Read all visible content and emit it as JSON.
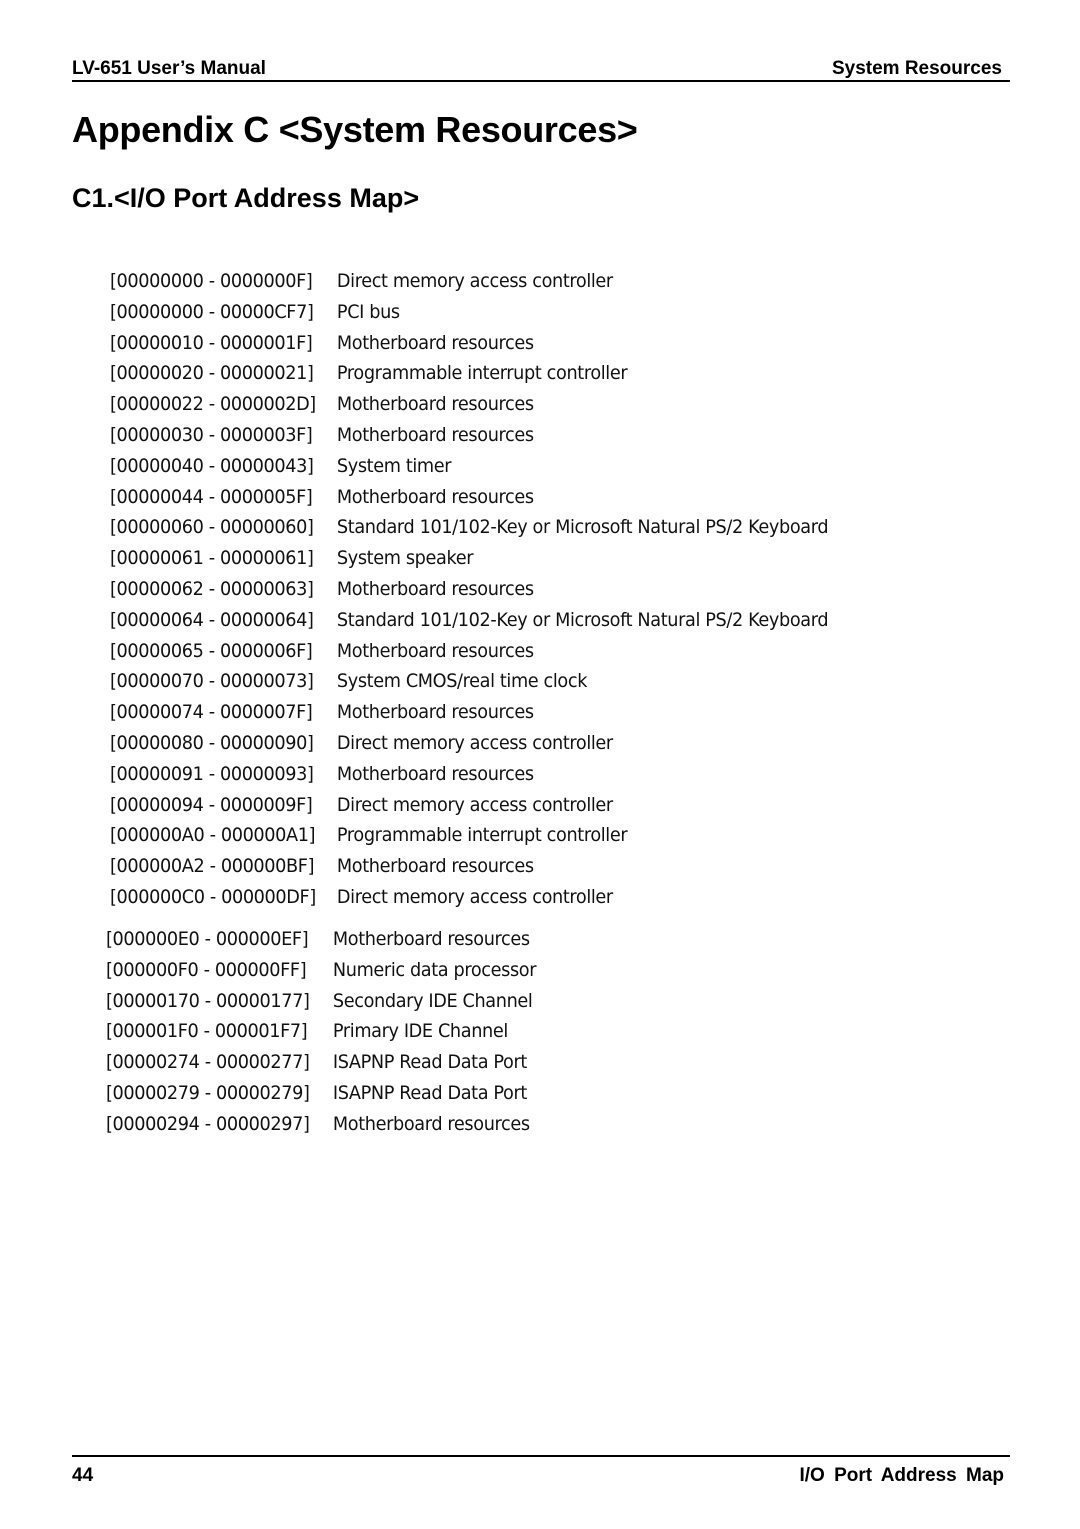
{
  "header": {
    "left": "LV-651 User’s Manual",
    "right": "System Resources"
  },
  "title": "Appendix C <System Resources>",
  "section_title": "C1.<I/O Port Address Map>",
  "io_ports": [
    {
      "range": "[00000000 - 0000000F]",
      "device": "Direct memory access controller"
    },
    {
      "range": "[00000000 - 00000CF7]",
      "device": "PCI bus"
    },
    {
      "range": "[00000010 - 0000001F]",
      "device": "Motherboard resources"
    },
    {
      "range": "[00000020 - 00000021]",
      "device": "Programmable interrupt controller"
    },
    {
      "range": "[00000022 - 0000002D]",
      "device": "Motherboard resources"
    },
    {
      "range": "[00000030 - 0000003F]",
      "device": "Motherboard resources"
    },
    {
      "range": "[00000040 - 00000043]",
      "device": "System timer"
    },
    {
      "range": "[00000044 - 0000005F]",
      "device": "Motherboard resources"
    },
    {
      "range": "[00000060 - 00000060]",
      "device": "Standard 101/102-Key or Microsoft Natural PS/2 Keyboard"
    },
    {
      "range": "[00000061 - 00000061]",
      "device": "System speaker"
    },
    {
      "range": "[00000062 - 00000063]",
      "device": "Motherboard resources"
    },
    {
      "range": "[00000064 - 00000064]",
      "device": "Standard 101/102-Key or Microsoft Natural PS/2 Keyboard"
    },
    {
      "range": "[00000065 - 0000006F]",
      "device": "Motherboard resources"
    },
    {
      "range": "[00000070 - 00000073]",
      "device": "System CMOS/real time clock"
    },
    {
      "range": "[00000074 - 0000007F]",
      "device": "Motherboard resources"
    },
    {
      "range": "[00000080 - 00000090]",
      "device": "Direct memory access controller"
    },
    {
      "range": "[00000091 - 00000093]",
      "device": "Motherboard resources"
    },
    {
      "range": "[00000094 - 0000009F]",
      "device": "Direct memory access controller"
    },
    {
      "range": "[000000A0 - 000000A1]",
      "device": "Programmable interrupt controller"
    },
    {
      "range": "[000000A2 - 000000BF]",
      "device": "Motherboard resources"
    },
    {
      "range": "[000000C0 - 000000DF]",
      "device": "Direct memory access controller"
    }
  ],
  "io_ports_continued": [
    {
      "range": "[000000E0 - 000000EF]",
      "device": "Motherboard resources"
    },
    {
      "range": "[000000F0 - 000000FF]",
      "device": "Numeric data processor"
    },
    {
      "range": "[00000170 - 00000177]",
      "device": "Secondary IDE Channel"
    },
    {
      "range": "[000001F0 - 000001F7]",
      "device": "Primary IDE Channel"
    },
    {
      "range": "[00000274 - 00000277]",
      "device": "ISAPNP Read Data Port"
    },
    {
      "range": "[00000279 - 00000279]",
      "device": "ISAPNP Read Data Port"
    },
    {
      "range": "[00000294 - 00000297]",
      "device": "Motherboard resources"
    }
  ],
  "footer": {
    "page_number": "44",
    "section": "I/O Port Address Map"
  }
}
